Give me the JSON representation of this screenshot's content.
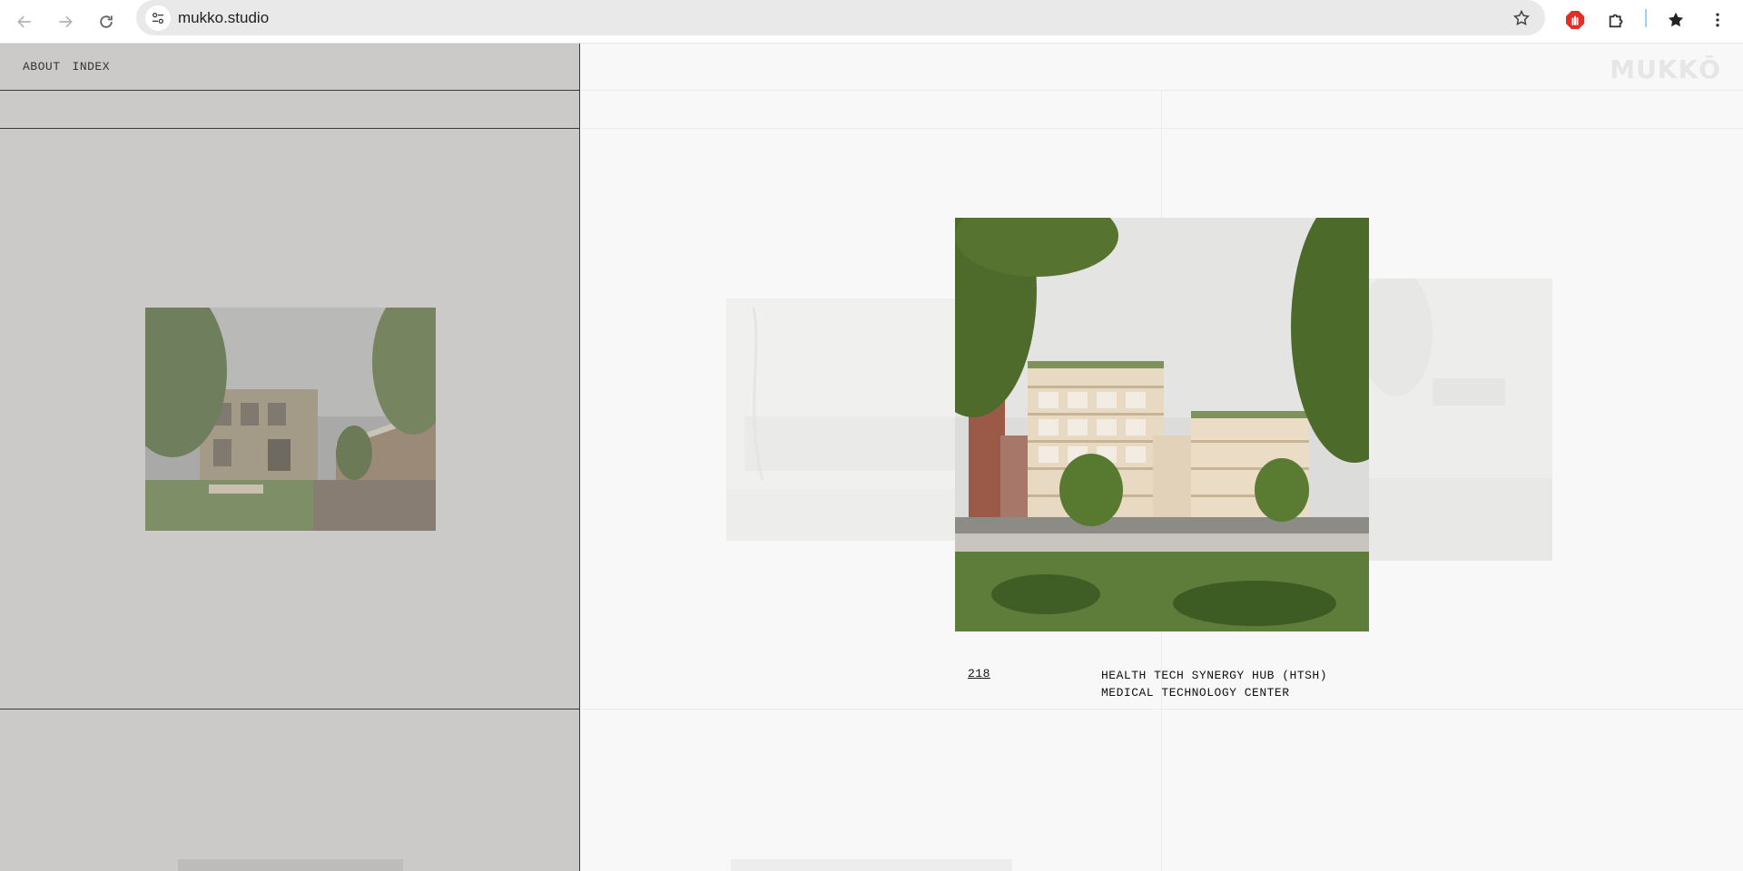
{
  "browser": {
    "url": "mukko.studio",
    "icons": {
      "back": "arrow-left-icon",
      "forward": "arrow-right-icon",
      "reload": "reload-icon",
      "site_info": "tune-icon",
      "bookmark": "star-outline-icon",
      "extension_1": "adblock-hand-icon",
      "extensions": "puzzle-icon",
      "bookmarks": "star-filled-icon",
      "menu": "kebab-menu-icon"
    }
  },
  "site": {
    "nav": {
      "about_label": "ABOUT",
      "index_label": "INDEX"
    },
    "logo_text": "MUKKŌ",
    "featured_project": {
      "number": "218",
      "title_line1": "HEALTH TECH SYNERGY HUB (HTSH)",
      "title_line2": "MEDICAL TECHNOLOGY CENTER"
    }
  },
  "colors": {
    "left_panel": "#cbcac8",
    "right_panel": "#f8f8f8",
    "adblock_red": "#e52d27"
  }
}
